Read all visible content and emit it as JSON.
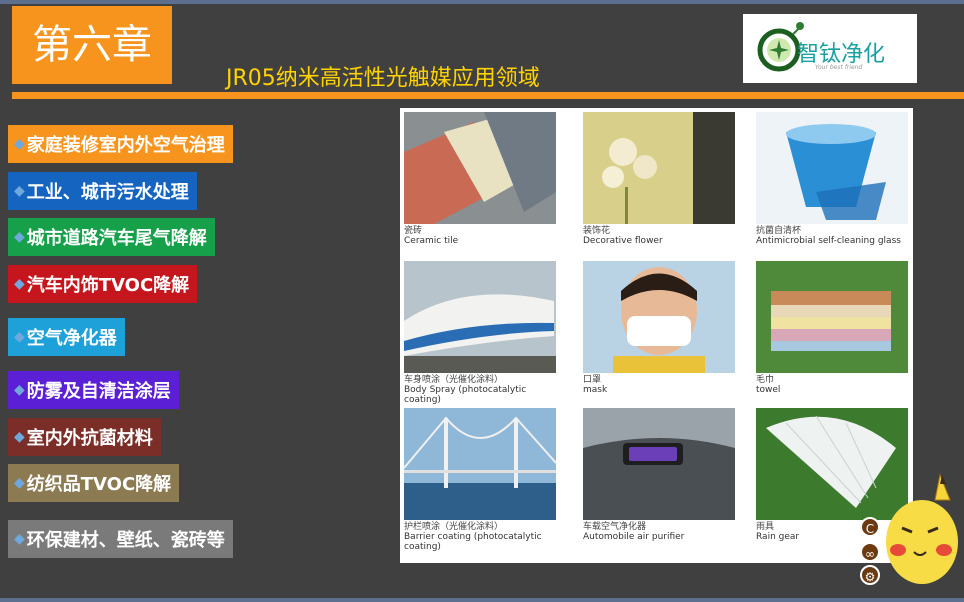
{
  "slide": {
    "chapter_label": "第六章",
    "title": "JR05纳米高活性光触媒应用领域",
    "logo": {
      "brand_text": "智钛净化",
      "tagline": "Your best friend"
    }
  },
  "applications": [
    {
      "label": "家庭装修室内外空气治理",
      "color": "#f7941d"
    },
    {
      "label": "工业、城市污水处理",
      "color": "#1565c0"
    },
    {
      "label": "城市道路汽车尾气降解",
      "color": "#16a04a"
    },
    {
      "label": "汽车内饰TVOC降解",
      "color": "#c4161c"
    },
    {
      "label": "空气净化器",
      "color": "#1ea0d8"
    },
    {
      "label": "防雾及自清洁涂层",
      "color": "#5b1fd6"
    },
    {
      "label": "室内外抗菌材料",
      "color": "#7b2e28"
    },
    {
      "label": "纺织品TVOC降解",
      "color": "#8b7a52"
    },
    {
      "label": "环保建材、壁纸、瓷砖等",
      "color": "#7a7a7a"
    }
  ],
  "gallery": [
    {
      "cn": "瓷砖",
      "en": "Ceramic tile"
    },
    {
      "cn": "装饰花",
      "en": "Decorative flower"
    },
    {
      "cn": "抗菌自清杯",
      "en": "Antimicrobial self-cleaning glass"
    },
    {
      "cn": "车身喷涂（光催化涂料）",
      "en": "Body Spray (photocatalytic coating)"
    },
    {
      "cn": "口罩",
      "en": "mask"
    },
    {
      "cn": "毛巾",
      "en": "towel"
    },
    {
      "cn": "护栏喷涂（光催化涂料）",
      "en": "Barrier coating (photocatalytic coating)"
    },
    {
      "cn": "车载空气净化器",
      "en": "Automobile air purifier"
    },
    {
      "cn": "雨具",
      "en": "Rain gear"
    }
  ],
  "nav": [
    {
      "icon": "c-letter-icon",
      "glyph": "C"
    },
    {
      "icon": "link-icon",
      "glyph": "∞"
    },
    {
      "icon": "gear-icon",
      "glyph": "⚙"
    }
  ]
}
